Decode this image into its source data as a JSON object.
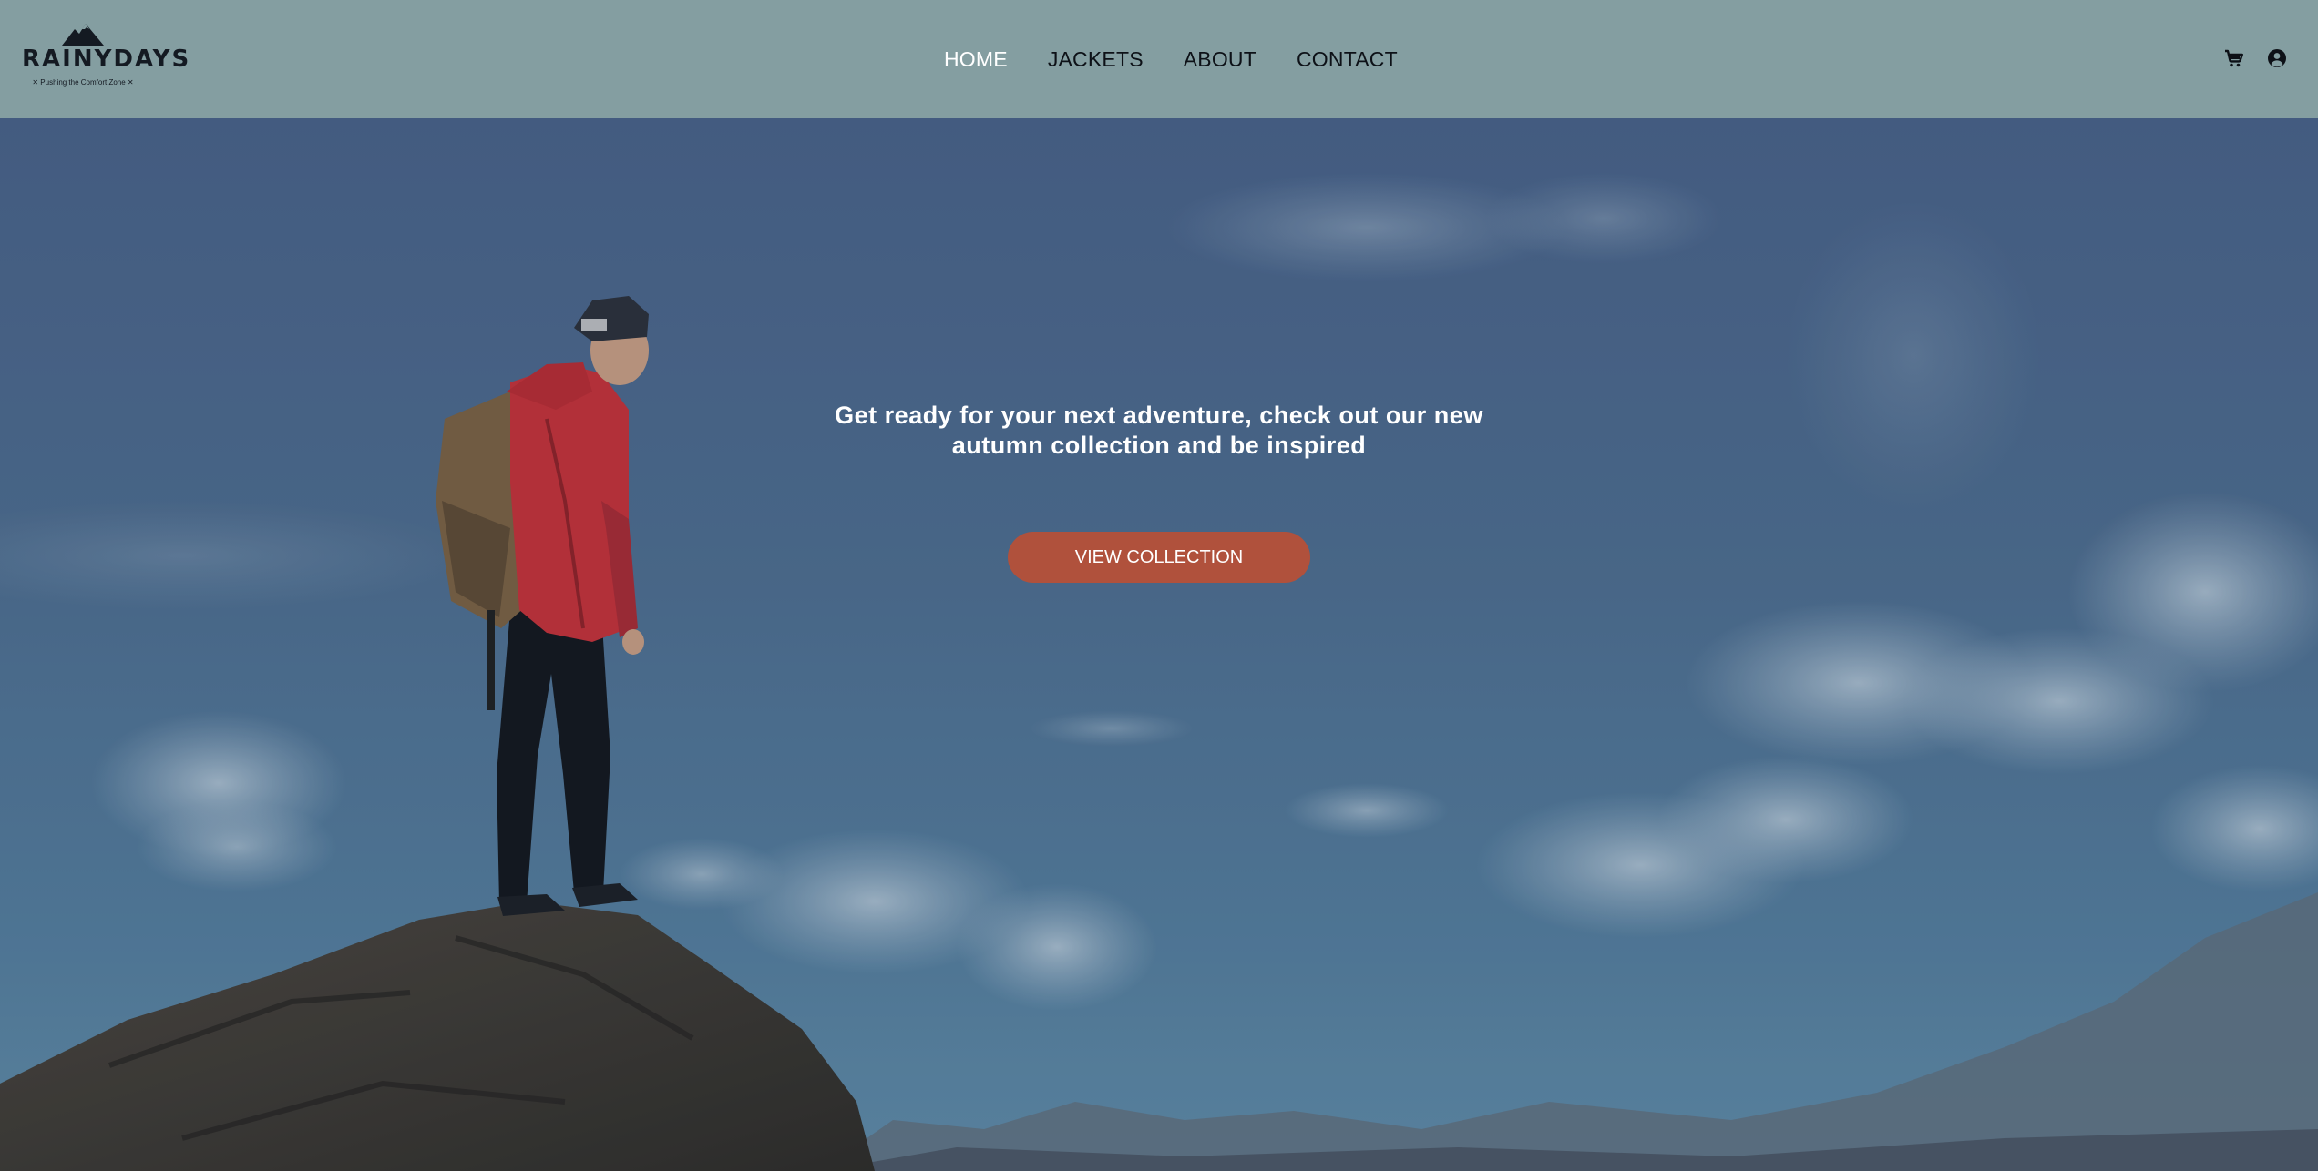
{
  "brand": {
    "name": "RAINYDAYS",
    "tagline": "✕ Pushing the Comfort Zone ✕"
  },
  "nav": {
    "items": [
      {
        "label": "HOME",
        "active": true
      },
      {
        "label": "JACKETS",
        "active": false
      },
      {
        "label": "ABOUT",
        "active": false
      },
      {
        "label": "CONTACT",
        "active": false
      }
    ]
  },
  "icons": {
    "cart": "cart-icon",
    "account": "account-icon"
  },
  "hero": {
    "headline_line1": "Get ready for your next adventure, check out our new",
    "headline_line2": "autumn collection and be inspired",
    "cta_label": "VIEW COLLECTION"
  },
  "colors": {
    "header_bg": "#849ea1",
    "accent": "#b0513c",
    "nav_active": "#ffffff",
    "nav_text": "#0d1117"
  }
}
